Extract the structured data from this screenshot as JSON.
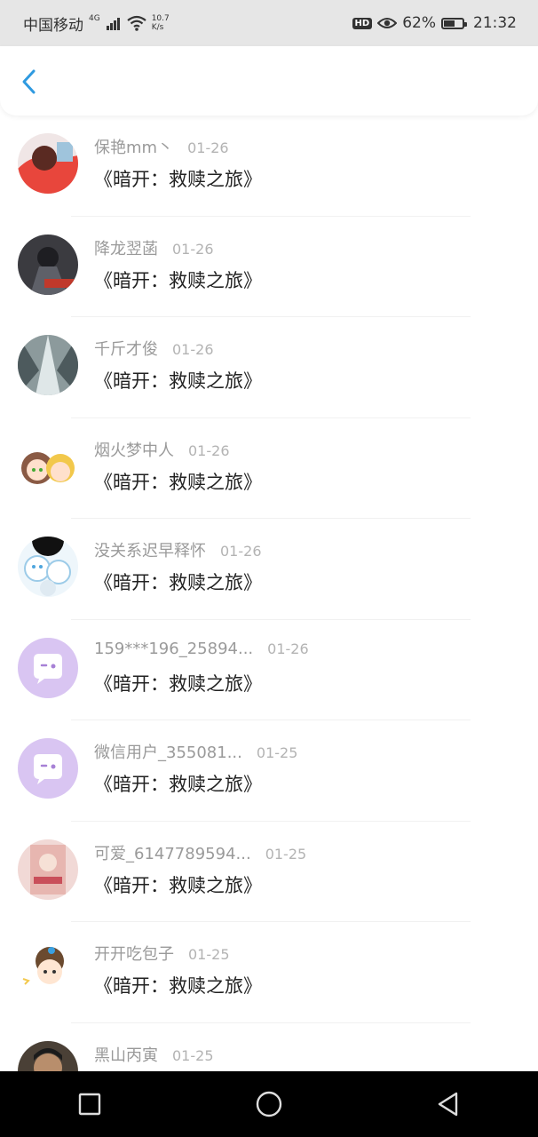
{
  "status_bar": {
    "carrier": "中国移动",
    "network": "4G",
    "speed_value": "10.7",
    "speed_unit": "K/s",
    "hd_badge": "HD",
    "battery": "62%",
    "battery_level": 0.62,
    "time": "21:32"
  },
  "header": {
    "back_icon": "chevron-left-icon"
  },
  "comments": [
    {
      "name": "保艳mm丶",
      "date": "01-26",
      "title": "《暗开：救赎之旅》",
      "avatar": "photo-red"
    },
    {
      "name": "降龙翌菡",
      "date": "01-26",
      "title": "《暗开：救赎之旅》",
      "avatar": "photo-dark"
    },
    {
      "name": "千斤才俊",
      "date": "01-26",
      "title": "《暗开：救赎之旅》",
      "avatar": "photo-tree"
    },
    {
      "name": "烟火梦中人",
      "date": "01-26",
      "title": "《暗开：救赎之旅》",
      "avatar": "cartoon-girls"
    },
    {
      "name": "没关系迟早释怀",
      "date": "01-26",
      "title": "《暗开：救赎之旅》",
      "avatar": "cartoon-cats"
    },
    {
      "name": "159***196_25894...",
      "date": "01-26",
      "title": "《暗开：救赎之旅》",
      "avatar": "default-chat"
    },
    {
      "name": "微信用户_355081...",
      "date": "01-25",
      "title": "《暗开：救赎之旅》",
      "avatar": "default-chat"
    },
    {
      "name": "可爱_6147789594...",
      "date": "01-25",
      "title": "《暗开：救赎之旅》",
      "avatar": "photo-girl"
    },
    {
      "name": "开开吃包子",
      "date": "01-25",
      "title": "《暗开：救赎之旅》",
      "avatar": "cartoon-boy"
    },
    {
      "name": "黑山丙寅",
      "date": "01-25",
      "title": "",
      "avatar": "photo-man"
    }
  ],
  "nav_bar": {
    "recent": "square-icon",
    "home": "circle-icon",
    "back": "triangle-back-icon"
  },
  "colors": {
    "accent": "#2f9ae0",
    "status_bg": "#e6e6e6",
    "default_avatar": "#d9c5f2"
  }
}
